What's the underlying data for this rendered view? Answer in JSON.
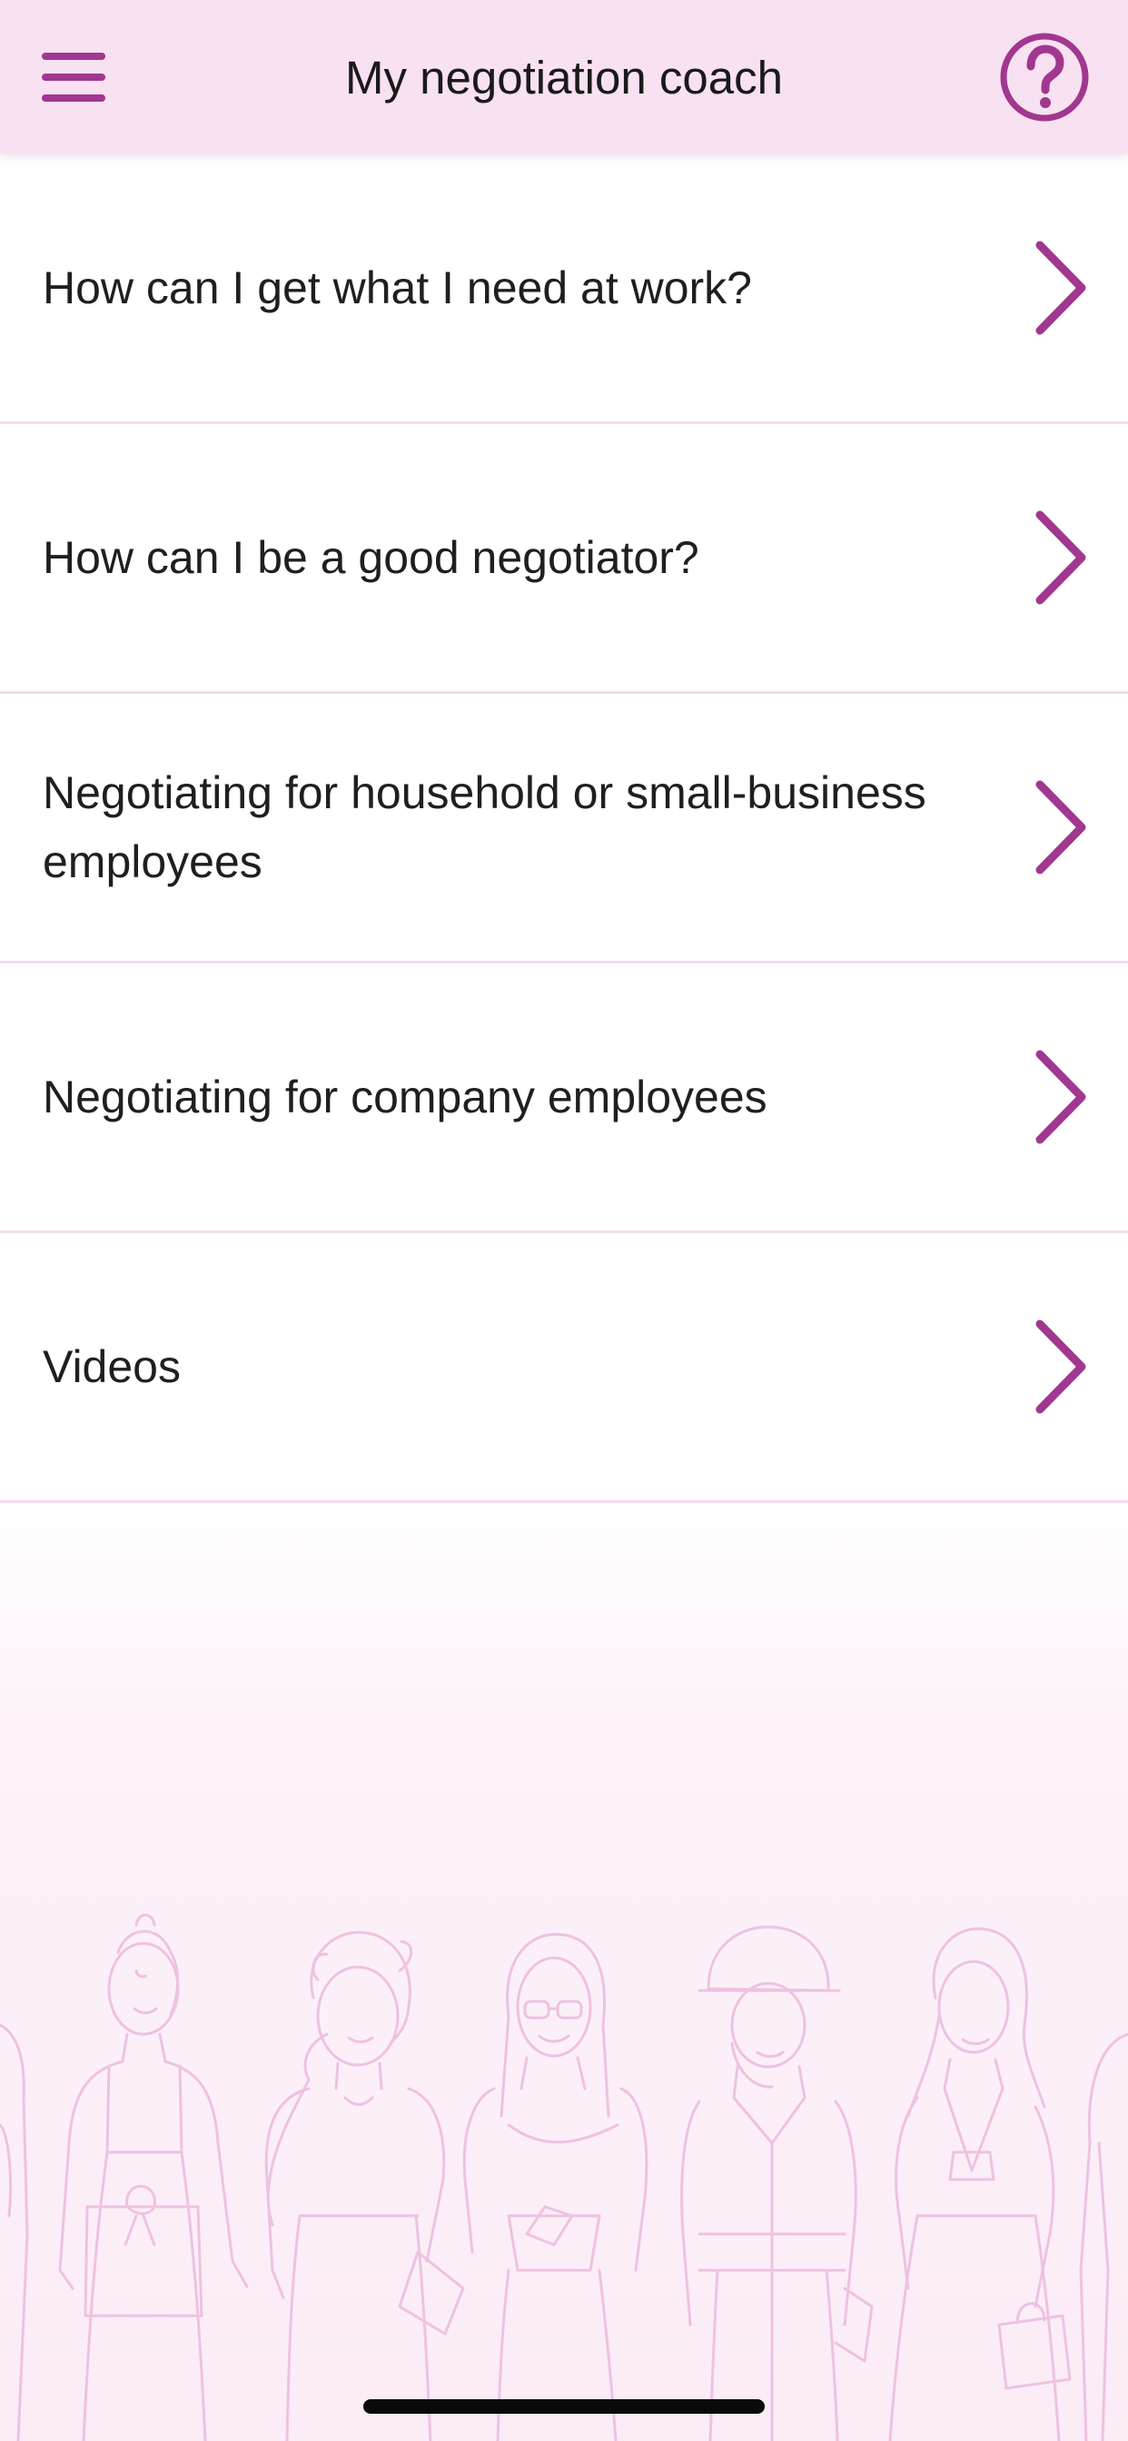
{
  "header": {
    "title": "My negotiation coach",
    "menu_icon": "hamburger-menu-icon",
    "help_icon": "question-circle-icon"
  },
  "menu": {
    "items": [
      {
        "label": "How can I get what I need at work?",
        "icon": "chevron-right-icon"
      },
      {
        "label": "How can I be a good negotiator?",
        "icon": "chevron-right-icon"
      },
      {
        "label": "Negotiating for household or small-business employees",
        "icon": "chevron-right-icon"
      },
      {
        "label": "Negotiating for company employees",
        "icon": "chevron-right-icon"
      },
      {
        "label": "Videos",
        "icon": "chevron-right-icon"
      }
    ]
  },
  "colors": {
    "accent": "#a1378f",
    "header_bg": "#f8e1f1",
    "divider": "#f6dbee",
    "illustration_line": "#eec2e0",
    "text": "#1f1f1f"
  }
}
